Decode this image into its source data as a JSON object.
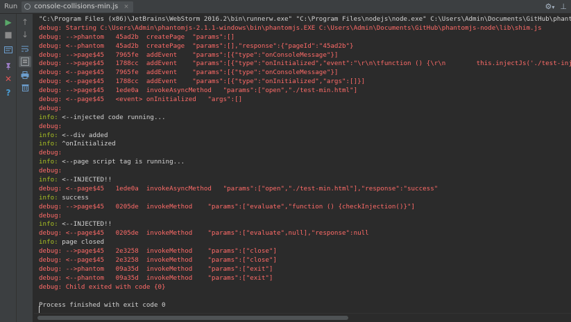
{
  "titlebar": {
    "run_label": "Run",
    "tab_name": "console-collisions-min.js",
    "tab_close": "×",
    "settings_glyph": "⚙",
    "settings_arrow": "▾",
    "pin_glyph": "⊥"
  },
  "toolbar": {
    "run_glyph": "▶",
    "stop_glyph": "■",
    "up_glyph": "↑",
    "down_glyph": "↓",
    "help_glyph": "?",
    "close_glyph": "✕",
    "colors": {
      "run": "#59a869",
      "stop": "#8a8a8a",
      "close": "#e05555",
      "help": "#4a9fd8",
      "tool": "#6d9fcf"
    }
  },
  "console": {
    "lines": [
      {
        "level": "plain",
        "label": "",
        "text": "\"C:\\Program Files (x86)\\JetBrains\\WebStorm 2016.2\\bin\\runnerw.exe\" \"C:\\Program Files\\nodejs\\node.exe\" C:\\Users\\Admin\\Documents\\GitHub\\phantomjs-no"
      },
      {
        "level": "debug",
        "label": "",
        "text": "debug: Starting C:\\Users\\Admin\\phantomjs-2.1.1-windows\\bin\\phantomjs.EXE C:\\Users\\Admin\\Documents\\GitHub\\phantomjs-node\\lib\\shim.js"
      },
      {
        "level": "debug",
        "label": "",
        "text": "debug: -->phantom   45ad2b  createPage  \"params\":[]"
      },
      {
        "level": "debug",
        "label": "",
        "text": "debug: <--phantom   45ad2b  createPage  \"params\":[],\"response\":{\"pageId\":\"45ad2b\"}"
      },
      {
        "level": "debug",
        "label": "",
        "text": "debug: -->page$45   7965fe  addEvent    \"params\":[{\"type\":\"onConsoleMessage\"}]"
      },
      {
        "level": "debug",
        "label": "",
        "text": "debug: -->page$45   1788cc  addEvent    \"params\":[{\"type\":\"onInitialized\",\"event\":\"\\r\\n\\tfunction () {\\r\\n        this.injectJs('./test-inject.js"
      },
      {
        "level": "debug",
        "label": "",
        "text": "debug: <--page$45   7965fe  addEvent    \"params\":[{\"type\":\"onConsoleMessage\"}]"
      },
      {
        "level": "debug",
        "label": "",
        "text": "debug: <--page$45   1788cc  addEvent    \"params\":[{\"type\":\"onInitialized\",\"args\":[]}]"
      },
      {
        "level": "debug",
        "label": "",
        "text": "debug: -->page$45   1ede0a  invokeAsyncMethod   \"params\":[\"open\",\"./test-min.html\"]"
      },
      {
        "level": "debug",
        "label": "",
        "text": "debug: <--page$45   <event> onInitialized   \"args\":[]"
      },
      {
        "level": "debug",
        "label": "",
        "text": "debug:"
      },
      {
        "level": "info",
        "label": "info:",
        "text": " <--injected code running..."
      },
      {
        "level": "debug",
        "label": "",
        "text": "debug:"
      },
      {
        "level": "info",
        "label": "info:",
        "text": " <--div added"
      },
      {
        "level": "info",
        "label": "info:",
        "text": " ^onInitialized"
      },
      {
        "level": "debug",
        "label": "",
        "text": "debug:"
      },
      {
        "level": "info",
        "label": "info:",
        "text": " <--page script tag is running..."
      },
      {
        "level": "debug",
        "label": "",
        "text": "debug:"
      },
      {
        "level": "info",
        "label": "info:",
        "text": " <--INJECTED!!"
      },
      {
        "level": "debug",
        "label": "",
        "text": "debug: <--page$45   1ede0a  invokeAsyncMethod   \"params\":[\"open\",\"./test-min.html\"],\"response\":\"success\""
      },
      {
        "level": "info",
        "label": "info:",
        "text": " success"
      },
      {
        "level": "debug",
        "label": "",
        "text": "debug: -->page$45   0205de  invokeMethod    \"params\":[\"evaluate\",\"function () {checkInjection()}\"]"
      },
      {
        "level": "debug",
        "label": "",
        "text": "debug:"
      },
      {
        "level": "info",
        "label": "info:",
        "text": " <--INJECTED!!"
      },
      {
        "level": "debug",
        "label": "",
        "text": "debug: <--page$45   0205de  invokeMethod    \"params\":[\"evaluate\",null],\"response\":null"
      },
      {
        "level": "info",
        "label": "info:",
        "text": " page closed"
      },
      {
        "level": "debug",
        "label": "",
        "text": "debug: -->page$45   2e3258  invokeMethod    \"params\":[\"close\"]"
      },
      {
        "level": "debug",
        "label": "",
        "text": "debug: <--page$45   2e3258  invokeMethod    \"params\":[\"close\"]"
      },
      {
        "level": "debug",
        "label": "",
        "text": "debug: -->phantom   09a35d  invokeMethod    \"params\":[\"exit\"]"
      },
      {
        "level": "debug",
        "label": "",
        "text": "debug: <--phantom   09a35d  invokeMethod    \"params\":[\"exit\"]"
      },
      {
        "level": "debug",
        "label": "",
        "text": "debug: Child exited with code {0}"
      },
      {
        "level": "plain",
        "label": "",
        "text": ""
      },
      {
        "level": "plain",
        "label": "",
        "text": "Process finished with exit code 0"
      }
    ]
  }
}
